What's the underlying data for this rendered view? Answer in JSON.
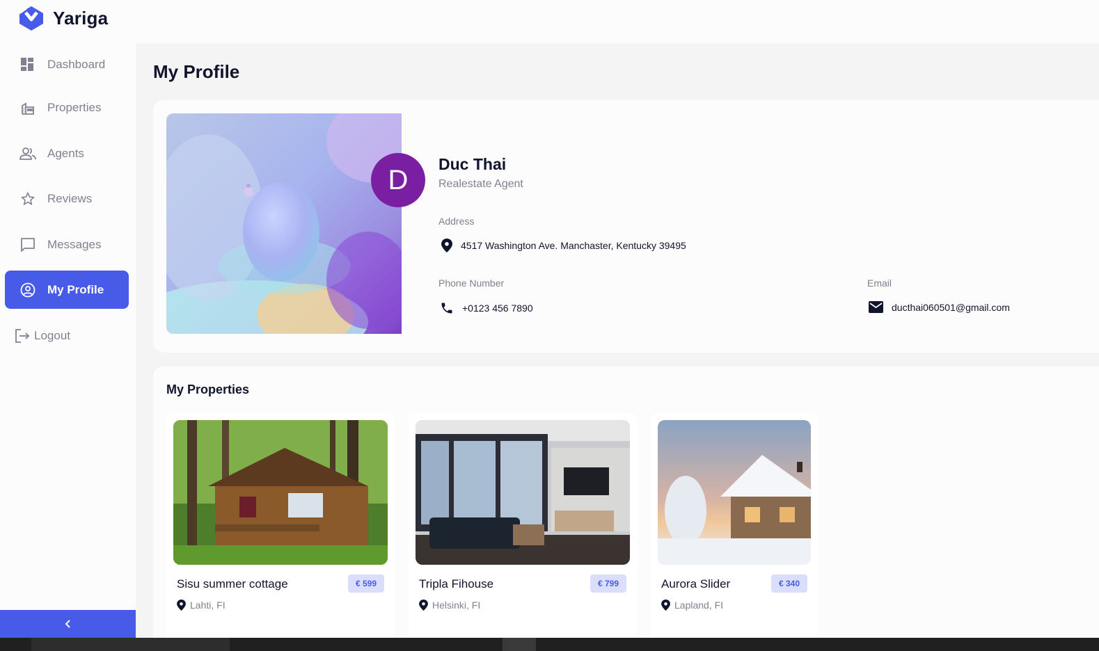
{
  "app": {
    "name": "Yariga",
    "accent": "#475be8"
  },
  "sidebar": {
    "items": [
      {
        "label": "Dashboard",
        "icon": "dashboard-icon"
      },
      {
        "label": "Properties",
        "icon": "building-icon"
      },
      {
        "label": "Agents",
        "icon": "people-icon"
      },
      {
        "label": "Reviews",
        "icon": "star-icon"
      },
      {
        "label": "Messages",
        "icon": "chat-icon"
      },
      {
        "label": "My Profile",
        "icon": "account-circle-icon",
        "active": true
      }
    ],
    "logout_label": "Logout",
    "collapse_icon": "chevron-left-icon"
  },
  "page": {
    "title": "My Profile"
  },
  "profile": {
    "avatar_initial": "D",
    "avatar_color": "#7b1fa2",
    "name": "Duc Thai",
    "role": "Realestate Agent",
    "address_label": "Address",
    "address": "4517 Washington Ave. Manchaster, Kentucky 39495",
    "phone_label": "Phone Number",
    "phone": "+0123 456 7890",
    "email_label": "Email",
    "email": "ducthai060501@gmail.com"
  },
  "properties": {
    "title": "My Properties",
    "items": [
      {
        "name": "Sisu summer cottage",
        "price": "€ 599",
        "location": "Lahti, FI"
      },
      {
        "name": "Tripla Fihouse",
        "price": "€ 799",
        "location": "Helsinki, FI"
      },
      {
        "name": "Aurora Slider",
        "price": "€ 340",
        "location": "Lapland, FI"
      }
    ]
  }
}
